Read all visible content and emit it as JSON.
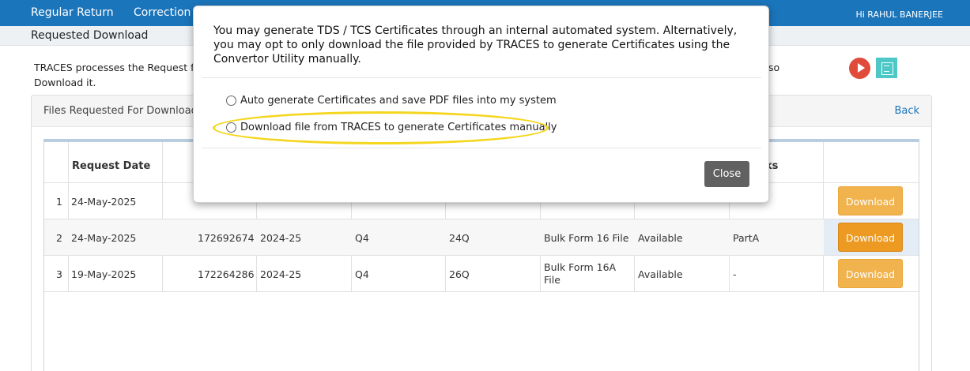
{
  "nav": {
    "items": [
      "Regular Return",
      "Correction"
    ],
    "user": "Hi RAHUL BANERJEE"
  },
  "page": {
    "title": "Requested Download"
  },
  "info": {
    "line1_start": "TRACES processes the Request for",
    "line1_end": "so",
    "line2": "Download it."
  },
  "panel": {
    "title": "Files Requested For Download",
    "back": "Back"
  },
  "table": {
    "headers": {
      "request_date": "Request Date",
      "remarks": "ks"
    },
    "rows": [
      {
        "no": "1",
        "date": "24-May-2025",
        "request_no": "",
        "fy": "",
        "quarter": "",
        "form": "",
        "type": "",
        "status": "",
        "remarks": "",
        "action": "Download"
      },
      {
        "no": "2",
        "date": "24-May-2025",
        "request_no": "172692674",
        "fy": "2024-25",
        "quarter": "Q4",
        "form": "24Q",
        "type": "Bulk Form 16 File",
        "status": "Available",
        "remarks": "PartA",
        "action": "Download"
      },
      {
        "no": "3",
        "date": "19-May-2025",
        "request_no": "172264286",
        "fy": "2024-25",
        "quarter": "Q4",
        "form": "26Q",
        "type_line1": "Bulk Form 16A",
        "type_line2": "File",
        "status": "Available",
        "remarks": "-",
        "action": "Download"
      }
    ]
  },
  "modal": {
    "message": "You may generate TDS / TCS Certificates through an internal automated system. Alternatively, you may opt to only download the file provided by TRACES to generate Certificates using the Convertor Utility manually.",
    "option_auto": "Auto generate Certificates and save PDF files into my system",
    "option_manual": "Download file from TRACES to generate Certificates manually",
    "close": "Close"
  },
  "colors": {
    "nav_bg": "#1b75bb",
    "download_btn": "#f0b34e",
    "download_btn_active": "#ec9a22",
    "highlight": "#f5d61e",
    "close_btn": "#616161"
  }
}
